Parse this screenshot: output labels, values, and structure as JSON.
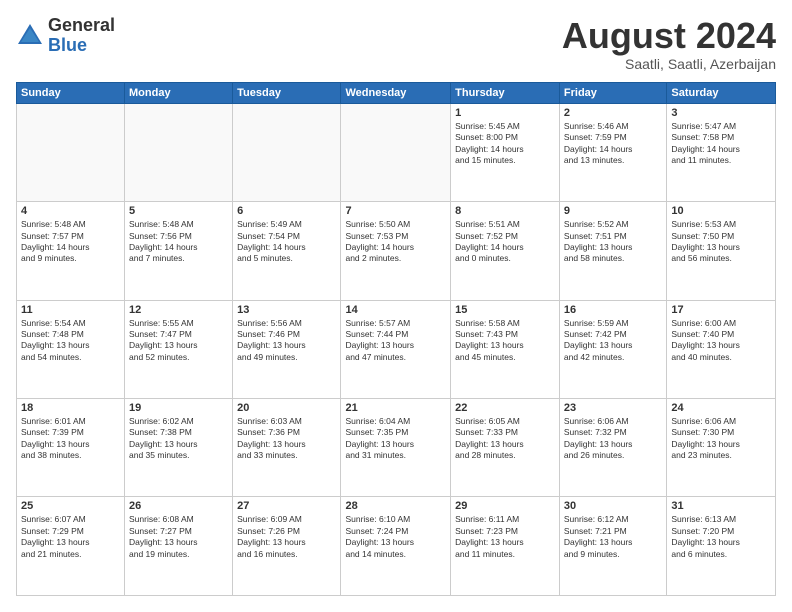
{
  "logo": {
    "general": "General",
    "blue": "Blue"
  },
  "title": "August 2024",
  "subtitle": "Saatli, Saatli, Azerbaijan",
  "days": [
    "Sunday",
    "Monday",
    "Tuesday",
    "Wednesday",
    "Thursday",
    "Friday",
    "Saturday"
  ],
  "weeks": [
    [
      {
        "day": "",
        "info": ""
      },
      {
        "day": "",
        "info": ""
      },
      {
        "day": "",
        "info": ""
      },
      {
        "day": "",
        "info": ""
      },
      {
        "day": "1",
        "info": "Sunrise: 5:45 AM\nSunset: 8:00 PM\nDaylight: 14 hours\nand 15 minutes."
      },
      {
        "day": "2",
        "info": "Sunrise: 5:46 AM\nSunset: 7:59 PM\nDaylight: 14 hours\nand 13 minutes."
      },
      {
        "day": "3",
        "info": "Sunrise: 5:47 AM\nSunset: 7:58 PM\nDaylight: 14 hours\nand 11 minutes."
      }
    ],
    [
      {
        "day": "4",
        "info": "Sunrise: 5:48 AM\nSunset: 7:57 PM\nDaylight: 14 hours\nand 9 minutes."
      },
      {
        "day": "5",
        "info": "Sunrise: 5:48 AM\nSunset: 7:56 PM\nDaylight: 14 hours\nand 7 minutes."
      },
      {
        "day": "6",
        "info": "Sunrise: 5:49 AM\nSunset: 7:54 PM\nDaylight: 14 hours\nand 5 minutes."
      },
      {
        "day": "7",
        "info": "Sunrise: 5:50 AM\nSunset: 7:53 PM\nDaylight: 14 hours\nand 2 minutes."
      },
      {
        "day": "8",
        "info": "Sunrise: 5:51 AM\nSunset: 7:52 PM\nDaylight: 14 hours\nand 0 minutes."
      },
      {
        "day": "9",
        "info": "Sunrise: 5:52 AM\nSunset: 7:51 PM\nDaylight: 13 hours\nand 58 minutes."
      },
      {
        "day": "10",
        "info": "Sunrise: 5:53 AM\nSunset: 7:50 PM\nDaylight: 13 hours\nand 56 minutes."
      }
    ],
    [
      {
        "day": "11",
        "info": "Sunrise: 5:54 AM\nSunset: 7:48 PM\nDaylight: 13 hours\nand 54 minutes."
      },
      {
        "day": "12",
        "info": "Sunrise: 5:55 AM\nSunset: 7:47 PM\nDaylight: 13 hours\nand 52 minutes."
      },
      {
        "day": "13",
        "info": "Sunrise: 5:56 AM\nSunset: 7:46 PM\nDaylight: 13 hours\nand 49 minutes."
      },
      {
        "day": "14",
        "info": "Sunrise: 5:57 AM\nSunset: 7:44 PM\nDaylight: 13 hours\nand 47 minutes."
      },
      {
        "day": "15",
        "info": "Sunrise: 5:58 AM\nSunset: 7:43 PM\nDaylight: 13 hours\nand 45 minutes."
      },
      {
        "day": "16",
        "info": "Sunrise: 5:59 AM\nSunset: 7:42 PM\nDaylight: 13 hours\nand 42 minutes."
      },
      {
        "day": "17",
        "info": "Sunrise: 6:00 AM\nSunset: 7:40 PM\nDaylight: 13 hours\nand 40 minutes."
      }
    ],
    [
      {
        "day": "18",
        "info": "Sunrise: 6:01 AM\nSunset: 7:39 PM\nDaylight: 13 hours\nand 38 minutes."
      },
      {
        "day": "19",
        "info": "Sunrise: 6:02 AM\nSunset: 7:38 PM\nDaylight: 13 hours\nand 35 minutes."
      },
      {
        "day": "20",
        "info": "Sunrise: 6:03 AM\nSunset: 7:36 PM\nDaylight: 13 hours\nand 33 minutes."
      },
      {
        "day": "21",
        "info": "Sunrise: 6:04 AM\nSunset: 7:35 PM\nDaylight: 13 hours\nand 31 minutes."
      },
      {
        "day": "22",
        "info": "Sunrise: 6:05 AM\nSunset: 7:33 PM\nDaylight: 13 hours\nand 28 minutes."
      },
      {
        "day": "23",
        "info": "Sunrise: 6:06 AM\nSunset: 7:32 PM\nDaylight: 13 hours\nand 26 minutes."
      },
      {
        "day": "24",
        "info": "Sunrise: 6:06 AM\nSunset: 7:30 PM\nDaylight: 13 hours\nand 23 minutes."
      }
    ],
    [
      {
        "day": "25",
        "info": "Sunrise: 6:07 AM\nSunset: 7:29 PM\nDaylight: 13 hours\nand 21 minutes."
      },
      {
        "day": "26",
        "info": "Sunrise: 6:08 AM\nSunset: 7:27 PM\nDaylight: 13 hours\nand 19 minutes."
      },
      {
        "day": "27",
        "info": "Sunrise: 6:09 AM\nSunset: 7:26 PM\nDaylight: 13 hours\nand 16 minutes."
      },
      {
        "day": "28",
        "info": "Sunrise: 6:10 AM\nSunset: 7:24 PM\nDaylight: 13 hours\nand 14 minutes."
      },
      {
        "day": "29",
        "info": "Sunrise: 6:11 AM\nSunset: 7:23 PM\nDaylight: 13 hours\nand 11 minutes."
      },
      {
        "day": "30",
        "info": "Sunrise: 6:12 AM\nSunset: 7:21 PM\nDaylight: 13 hours\nand 9 minutes."
      },
      {
        "day": "31",
        "info": "Sunrise: 6:13 AM\nSunset: 7:20 PM\nDaylight: 13 hours\nand 6 minutes."
      }
    ]
  ]
}
